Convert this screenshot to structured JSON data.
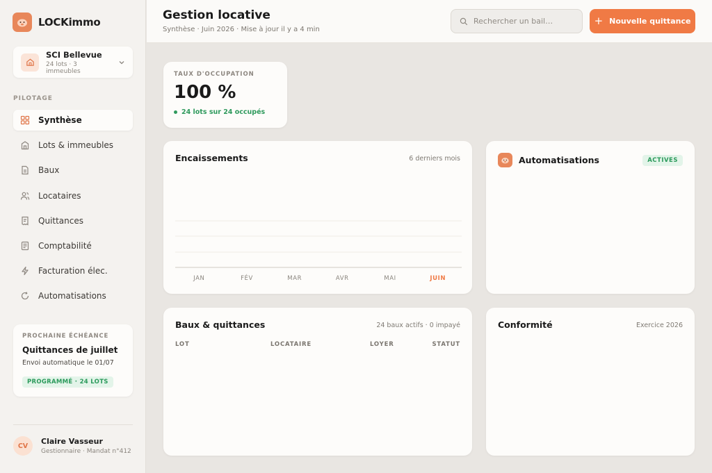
{
  "app": {
    "name": "LOCKimmo"
  },
  "org": {
    "name": "SCI Bellevue",
    "sub": "24 lots · 3 immeubles"
  },
  "sidebar": {
    "section_label": "PILOTAGE",
    "items": [
      {
        "label": "Synthèse",
        "icon": "grid-icon"
      },
      {
        "label": "Lots & immeubles",
        "icon": "building-icon"
      },
      {
        "label": "Baux",
        "icon": "document-icon"
      },
      {
        "label": "Locataires",
        "icon": "users-icon"
      },
      {
        "label": "Quittances",
        "icon": "receipt-icon"
      },
      {
        "label": "Comptabilité",
        "icon": "ledger-icon"
      },
      {
        "label": "Facturation élec.",
        "icon": "bolt-icon"
      },
      {
        "label": "Automatisations",
        "icon": "refresh-icon"
      }
    ],
    "due": {
      "label": "PROCHAINE ÉCHÉANCE",
      "title": "Quittances de juillet",
      "sub": "Envoi automatique le 01/07",
      "badge": "PROGRAMMÉ · 24 LOTS"
    },
    "user": {
      "initials": "CV",
      "name": "Claire Vasseur",
      "role": "Gestionnaire · Mandat n°412"
    }
  },
  "header": {
    "title": "Gestion locative",
    "sub": "Synthèse · Juin 2026 · Mise à jour il y a 4 min",
    "search_placeholder": "Rechercher un bail…",
    "new_button": "Nouvelle quittance"
  },
  "occupancy": {
    "label": "TAUX D'OCCUPATION",
    "value": "100 %",
    "note": "24 lots sur 24 occupés",
    "fraction": 1.0
  },
  "collections": {
    "title": "Encaissements",
    "meta": "6 derniers mois",
    "months": [
      "JAN",
      "FÉV",
      "MAR",
      "AVR",
      "MAI",
      "JUIN"
    ],
    "active_month": "JUIN"
  },
  "automations": {
    "title": "Automatisations",
    "badge": "ACTIVES"
  },
  "leases": {
    "title": "Baux & quittances",
    "meta": "24 baux actifs · 0 impayé",
    "columns": [
      "LOT",
      "LOCATAIRE",
      "LOYER",
      "STATUT"
    ]
  },
  "compliance": {
    "title": "Conformité",
    "meta": "Exercice 2026"
  },
  "colors": {
    "accent": "#f07a45",
    "success": "#2f9a5d",
    "sidebar_bg": "#f4f2ef"
  }
}
